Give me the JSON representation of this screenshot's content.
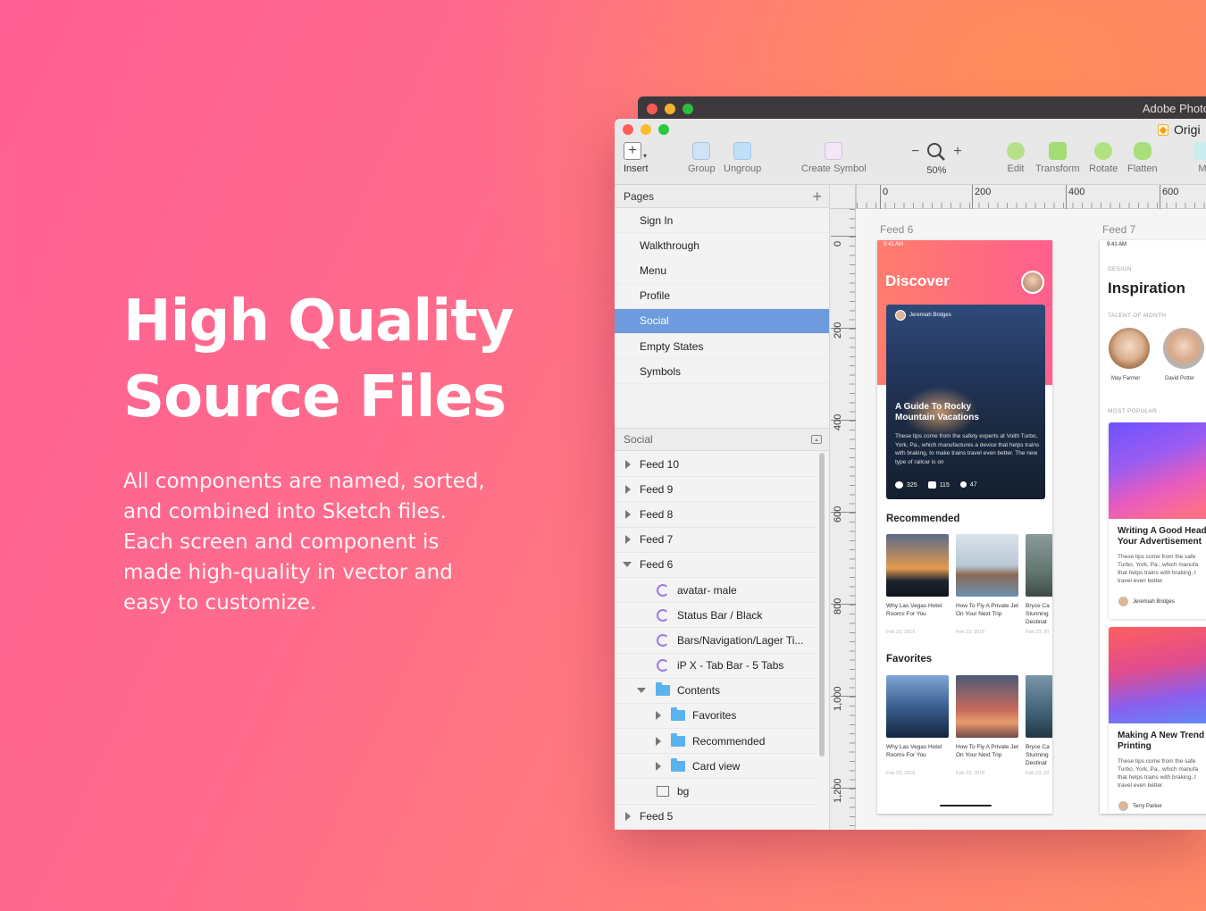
{
  "hero": {
    "title_line1": "High Quality",
    "title_line2": "Source Files",
    "body_lines": [
      "All components are named, sorted,",
      "and combined into Sketch files.",
      "Each screen and component is",
      "made high-quality in vector and",
      "easy to customize."
    ]
  },
  "back_window": {
    "title": "Adobe Photo"
  },
  "window": {
    "document_title": "Origi",
    "toolbar": {
      "insert": "Insert",
      "group": "Group",
      "ungroup": "Ungroup",
      "create_symbol": "Create Symbol",
      "zoom": "50%",
      "zoom_minus": "−",
      "zoom_plus": "+",
      "edit": "Edit",
      "transform": "Transform",
      "rotate": "Rotate",
      "flatten": "Flatten",
      "more": "M"
    },
    "pages": {
      "header": "Pages",
      "items": [
        "Sign In",
        "Walkthrough",
        "Menu",
        "Profile",
        "Social",
        "Empty States",
        "Symbols"
      ],
      "selected": "Social"
    },
    "layers": {
      "header": "Social",
      "items": [
        {
          "label": "Feed 10",
          "kind": "artboard",
          "state": "collapsed"
        },
        {
          "label": "Feed 9",
          "kind": "artboard",
          "state": "collapsed"
        },
        {
          "label": "Feed 8",
          "kind": "artboard",
          "state": "collapsed"
        },
        {
          "label": "Feed 7",
          "kind": "artboard",
          "state": "collapsed"
        },
        {
          "label": "Feed 6",
          "kind": "artboard",
          "state": "expanded"
        },
        {
          "label": "avatar- male",
          "kind": "symbol"
        },
        {
          "label": "Status Bar / Black",
          "kind": "symbol"
        },
        {
          "label": "Bars/Navigation/Lager Ti...",
          "kind": "symbol"
        },
        {
          "label": "iP X - Tab Bar - 5 Tabs",
          "kind": "symbol"
        },
        {
          "label": "Contents",
          "kind": "folder",
          "state": "expanded"
        },
        {
          "label": "Favorites",
          "kind": "folder",
          "state": "collapsed"
        },
        {
          "label": "Recommended",
          "kind": "folder",
          "state": "collapsed"
        },
        {
          "label": "Card view",
          "kind": "folder",
          "state": "collapsed"
        },
        {
          "label": "bg",
          "kind": "rectangle"
        },
        {
          "label": "Feed 5",
          "kind": "artboard",
          "state": "collapsed"
        }
      ]
    },
    "rulers": {
      "horizontal": [
        "0",
        "200",
        "400",
        "600"
      ],
      "vertical": [
        "0",
        "200",
        "400",
        "600",
        "800",
        "1,000",
        "1,200"
      ]
    },
    "feed6": {
      "label": "Feed 6",
      "status_time": "9:41 AM",
      "title": "Discover",
      "hero_author": "Jeremiah Bridges",
      "hero_title": "A Guide To Rocky Mountain Vacations",
      "hero_body": "These tips come from the safety experts at Voith Turbo, York, Pa., which manufactures a device that helps trains with braking, to make trains travel even better. The new type of railcar is on",
      "likes": "325",
      "comments": "115",
      "shares": "47",
      "recommended_title": "Recommended",
      "favorites_title": "Favorites",
      "recommended": [
        {
          "caption": "Why Las Vegas Hotel Rooms For You",
          "date": "Feb 23, 2016"
        },
        {
          "caption": "How To Fly A Private Jet On Your Next Trip",
          "date": "Feb 23, 2016"
        },
        {
          "caption": "Bryce Ca Stunning Destinat",
          "date": "Feb 23, 20"
        }
      ],
      "favorites": [
        {
          "caption": "Why Las Vegas Hotel Rooms For You",
          "date": "Feb 23, 2016"
        },
        {
          "caption": "How To Fly A Private Jet On Your Next Trip",
          "date": "Feb 23, 2016"
        },
        {
          "caption": "Bryce Ca Stunning Destinat",
          "date": "Feb 23, 20"
        }
      ]
    },
    "feed7": {
      "label": "Feed 7",
      "status_time": "9:41 AM",
      "design_cap": "DESIGN",
      "title": "Inspiration",
      "talent_cap": "TALENT OF MONTH",
      "talent": [
        "May Farmer",
        "David Potter"
      ],
      "popular_cap": "MOST POPULAR",
      "cards": [
        {
          "title_line1": "Writing A Good Head",
          "title_line2": "Your Advertisement",
          "body_lines": [
            "These tips come from the safe",
            "Turbo, York, Pa., which manufa",
            "that helps trains with braking, t",
            "travel even better."
          ],
          "author": "Jeremiah Bridges"
        },
        {
          "title_line1": "Making A New Trend",
          "title_line2": "Printing",
          "body_lines": [
            "These tips come from the safe",
            "Turbo, York, Pa., which manufa",
            "that helps trains with braking, t",
            "travel even better."
          ],
          "author": "Terry Parker"
        }
      ]
    }
  },
  "colors": {
    "selection": "#6d9bde",
    "traffic_red": "#ff5f57",
    "traffic_yellow": "#febc2e",
    "traffic_green": "#28c840"
  }
}
